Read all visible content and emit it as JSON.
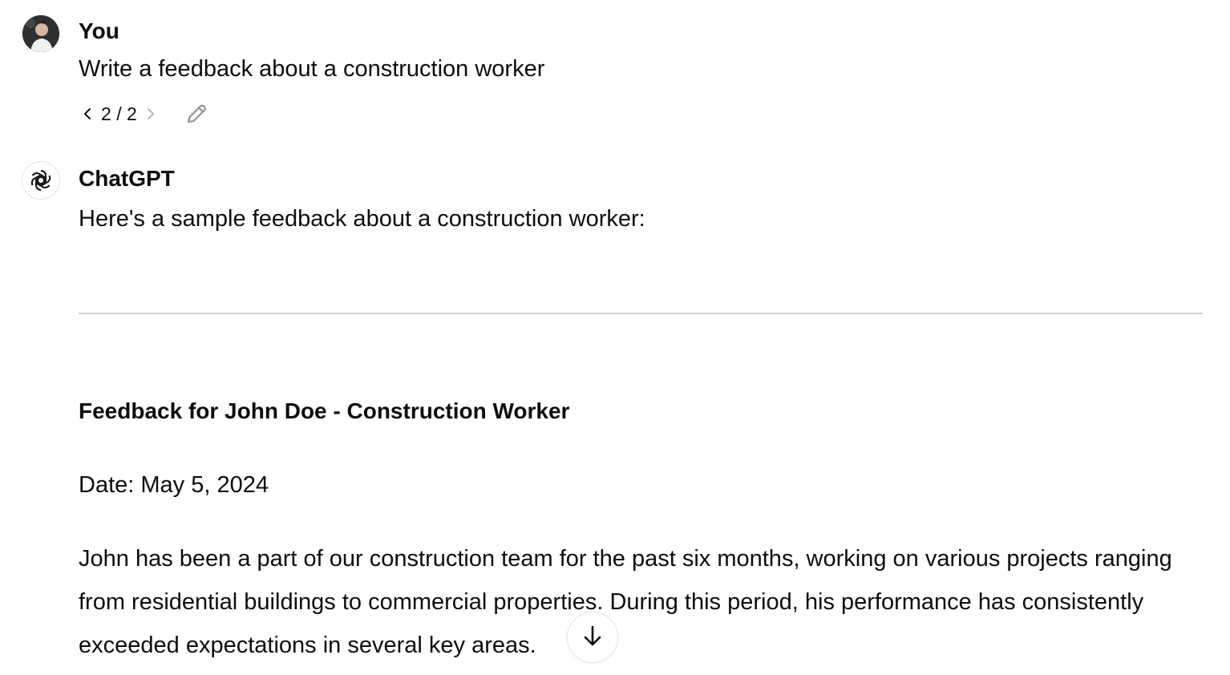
{
  "conversation": {
    "user": {
      "author": "You",
      "message": "Write a feedback about a construction worker",
      "pager": {
        "current": "2",
        "separator": "/",
        "total": "2"
      }
    },
    "assistant": {
      "author": "ChatGPT",
      "intro": "Here's a sample feedback about a construction worker:",
      "heading": "Feedback for John Doe - Construction Worker",
      "date_line": "Date: May 5, 2024",
      "paragraph": "John has been a part of our construction team for the past six months, working on various projects ranging from residential buildings to commercial properties. During this period, his performance has consistently exceeded expectations in several key areas."
    }
  },
  "icons": {
    "prev": "chevron-left-icon",
    "next": "chevron-right-icon",
    "edit": "pencil-icon",
    "assistant_logo": "openai-logo-icon",
    "scroll": "arrow-down-icon"
  },
  "colors": {
    "text": "#0d0d0d",
    "muted": "#9b9b9b",
    "divider": "#cfcfcf",
    "background": "#ffffff"
  }
}
